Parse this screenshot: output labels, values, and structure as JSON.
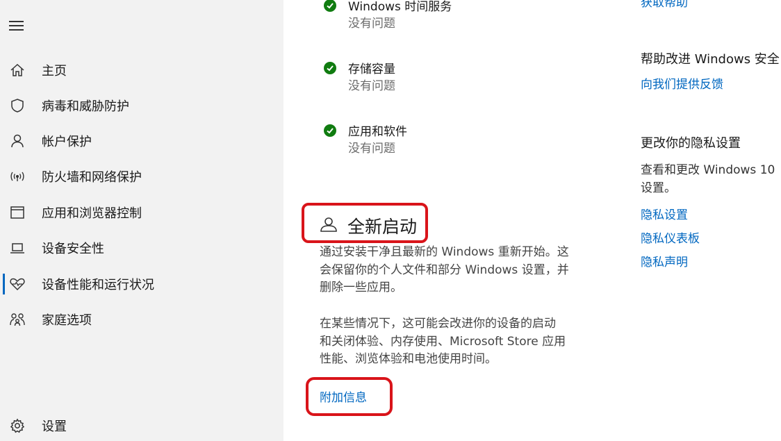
{
  "sidebar": {
    "items": [
      {
        "label": "主页",
        "icon": "home-icon"
      },
      {
        "label": "病毒和威胁防护",
        "icon": "shield-icon"
      },
      {
        "label": "帐户保护",
        "icon": "person-icon"
      },
      {
        "label": "防火墙和网络保护",
        "icon": "wireless-signal-icon"
      },
      {
        "label": "应用和浏览器控制",
        "icon": "app-window-icon"
      },
      {
        "label": "设备安全性",
        "icon": "laptop-icon"
      },
      {
        "label": "设备性能和运行状况",
        "icon": "heart-pulse-icon"
      },
      {
        "label": "家庭选项",
        "icon": "family-icon"
      }
    ],
    "settings_label": "设置",
    "active_index": 6
  },
  "status_items": [
    {
      "title": "Windows 时间服务",
      "subtitle": "没有问题"
    },
    {
      "title": "存储容量",
      "subtitle": "没有问题"
    },
    {
      "title": "应用和软件",
      "subtitle": "没有问题"
    }
  ],
  "fresh_start": {
    "title": "全新启动",
    "paragraph1": [
      "通过安装干净且最新的 Windows 重新开始。这",
      "会保留你的个人文件和部分 Windows 设置，并",
      "删除一些应用。"
    ],
    "paragraph2": [
      "在某些情况下，这可能会改进你的设备的启动",
      "和关闭体验、内存使用、Microsoft Store 应用",
      "性能、浏览体验和电池使用时间。"
    ],
    "more_info_link": "附加信息"
  },
  "right_panel": {
    "get_help_link": "获取帮助",
    "improve_heading": "帮助改进 Windows 安全",
    "feedback_link": "向我们提供反馈",
    "privacy_heading": "更改你的隐私设置",
    "privacy_text": [
      "查看和更改 Windows 10",
      "设置。"
    ],
    "privacy_links": [
      "隐私设置",
      "隐私仪表板",
      "隐私声明"
    ]
  },
  "colors": {
    "accent": "#0067c0",
    "success": "#107c10",
    "highlight_box": "#d9141a",
    "sidebar_bg": "#f2f2f2"
  }
}
